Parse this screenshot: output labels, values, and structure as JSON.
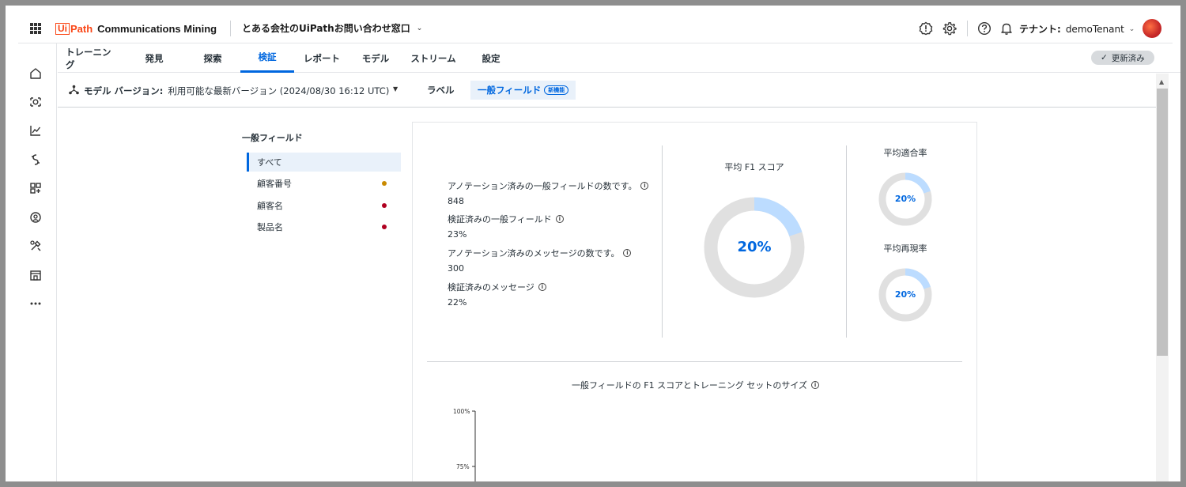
{
  "header": {
    "logo_ui": "Ui",
    "logo_path": "Path",
    "product": "Communications Mining",
    "project": "とある会社のUiPathお問い合わせ窓口",
    "tenant_label": "テナント:",
    "tenant_value": "demoTenant"
  },
  "tabs": [
    {
      "label": "トレーニング"
    },
    {
      "label": "発見"
    },
    {
      "label": "探索"
    },
    {
      "label": "検証",
      "active": true
    },
    {
      "label": "レポート"
    },
    {
      "label": "モデル"
    },
    {
      "label": "ストリーム"
    },
    {
      "label": "設定"
    }
  ],
  "status_badge": "更新済み",
  "subbar": {
    "model_version_label": "モデル バージョン:",
    "model_version_value": "利用可能な最新バージョン (2024/08/30 16:12 UTC)",
    "tab_labels": "ラベル",
    "tab_fields": "一般フィールド",
    "new_badge": "新機能"
  },
  "field_list": {
    "title": "一般フィールド",
    "items": [
      {
        "label": "すべて",
        "active": true
      },
      {
        "label": "顧客番号",
        "dot_color": "#c98a00"
      },
      {
        "label": "顧客名",
        "dot_color": "#b00020"
      },
      {
        "label": "製品名",
        "dot_color": "#b00020"
      }
    ]
  },
  "stats": [
    {
      "label": "アノテーション済みの一般フィールドの数です。",
      "value": "848"
    },
    {
      "label": "検証済みの一般フィールド",
      "value": "23%"
    },
    {
      "label": "アノテーション済みのメッセージの数です。",
      "value": "300"
    },
    {
      "label": "検証済みのメッセージ",
      "value": "22%"
    }
  ],
  "metrics": {
    "f1": {
      "title": "平均 F1 スコア",
      "value_label": "20%",
      "fraction": 0.2
    },
    "precision": {
      "title": "平均適合率",
      "value_label": "20%",
      "fraction": 0.2
    },
    "recall": {
      "title": "平均再現率",
      "value_label": "20%",
      "fraction": 0.2
    }
  },
  "chart": {
    "title": "一般フィールドの F1 スコアとトレーニング セットのサイズ",
    "y_ticks": [
      "100%",
      "75%"
    ]
  },
  "colors": {
    "accent": "#0067df",
    "donut_fill": "#bcdcff",
    "donut_track": "#e0e0e0"
  }
}
